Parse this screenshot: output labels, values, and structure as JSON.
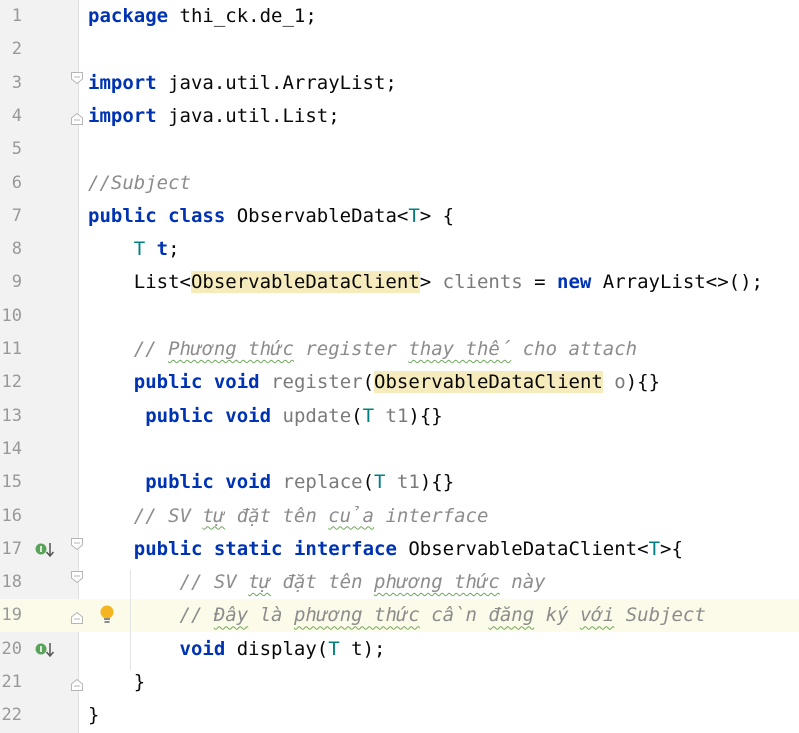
{
  "editor": {
    "lines": [
      {
        "n": "1",
        "tokens": [
          {
            "t": "package",
            "c": "kw"
          },
          {
            "t": " thi_ck.de_1;"
          }
        ]
      },
      {
        "n": "2",
        "tokens": []
      },
      {
        "n": "3",
        "tokens": [
          {
            "t": "import",
            "c": "kw"
          },
          {
            "t": " java.util.ArrayList;"
          }
        ]
      },
      {
        "n": "4",
        "tokens": [
          {
            "t": "import",
            "c": "kw"
          },
          {
            "t": " java.util.List;"
          }
        ]
      },
      {
        "n": "5",
        "tokens": []
      },
      {
        "n": "6",
        "tokens": [
          {
            "t": "//Subject",
            "c": "cm"
          }
        ]
      },
      {
        "n": "7",
        "tokens": [
          {
            "t": "public",
            "c": "kw"
          },
          {
            "t": " "
          },
          {
            "t": "class",
            "c": "kw"
          },
          {
            "t": " ObservableData<"
          },
          {
            "t": "T",
            "c": "tp"
          },
          {
            "t": "> {"
          }
        ]
      },
      {
        "n": "8",
        "tokens": [
          {
            "t": "    "
          },
          {
            "t": "T",
            "c": "tp"
          },
          {
            "t": " "
          },
          {
            "t": "t",
            "c": "kw"
          },
          {
            "t": ";"
          }
        ]
      },
      {
        "n": "9",
        "tokens": [
          {
            "t": "    List<"
          },
          {
            "t": "ObservableDataClient",
            "c": "hl"
          },
          {
            "t": "> "
          },
          {
            "t": "clients",
            "c": "gr"
          },
          {
            "t": " = "
          },
          {
            "t": "new",
            "c": "kw"
          },
          {
            "t": " ArrayList<>();"
          }
        ]
      },
      {
        "n": "10",
        "tokens": []
      },
      {
        "n": "11",
        "tokens": [
          {
            "t": "    // ",
            "c": "cm"
          },
          {
            "t": "Phương thức",
            "c": "cm wav"
          },
          {
            "t": " register ",
            "c": "cm"
          },
          {
            "t": "thay thế",
            "c": "cm wav"
          },
          {
            "t": " cho attach",
            "c": "cm"
          }
        ]
      },
      {
        "n": "12",
        "tokens": [
          {
            "t": "    "
          },
          {
            "t": "public",
            "c": "kw"
          },
          {
            "t": " "
          },
          {
            "t": "void",
            "c": "kw"
          },
          {
            "t": " "
          },
          {
            "t": "register",
            "c": "gr"
          },
          {
            "t": "("
          },
          {
            "t": "ObservableDataClient",
            "c": "hl"
          },
          {
            "t": " "
          },
          {
            "t": "o",
            "c": "gr"
          },
          {
            "t": "){}"
          }
        ]
      },
      {
        "n": "13",
        "tokens": [
          {
            "t": "     "
          },
          {
            "t": "public",
            "c": "kw"
          },
          {
            "t": " "
          },
          {
            "t": "void",
            "c": "kw"
          },
          {
            "t": " "
          },
          {
            "t": "update",
            "c": "gr"
          },
          {
            "t": "("
          },
          {
            "t": "T",
            "c": "tp"
          },
          {
            "t": " "
          },
          {
            "t": "t1",
            "c": "gr"
          },
          {
            "t": "){}"
          }
        ]
      },
      {
        "n": "14",
        "tokens": []
      },
      {
        "n": "15",
        "tokens": [
          {
            "t": "     "
          },
          {
            "t": "public",
            "c": "kw"
          },
          {
            "t": " "
          },
          {
            "t": "void",
            "c": "kw"
          },
          {
            "t": " "
          },
          {
            "t": "replace",
            "c": "gr"
          },
          {
            "t": "("
          },
          {
            "t": "T",
            "c": "tp"
          },
          {
            "t": " "
          },
          {
            "t": "t1",
            "c": "gr"
          },
          {
            "t": "){}"
          }
        ]
      },
      {
        "n": "16",
        "tokens": [
          {
            "t": "    // SV ",
            "c": "cm"
          },
          {
            "t": "tự",
            "c": "cm wav"
          },
          {
            "t": " đặt tên ",
            "c": "cm"
          },
          {
            "t": "của",
            "c": "cm wav"
          },
          {
            "t": " interface",
            "c": "cm"
          }
        ]
      },
      {
        "n": "17",
        "tokens": [
          {
            "t": "    "
          },
          {
            "t": "public",
            "c": "kw"
          },
          {
            "t": " "
          },
          {
            "t": "static",
            "c": "kw"
          },
          {
            "t": " "
          },
          {
            "t": "interface",
            "c": "kw"
          },
          {
            "t": " ObservableDataClient<"
          },
          {
            "t": "T",
            "c": "tp"
          },
          {
            "t": ">{"
          }
        ]
      },
      {
        "n": "18",
        "tokens": [
          {
            "t": "        // SV ",
            "c": "cm"
          },
          {
            "t": "tự",
            "c": "cm wav"
          },
          {
            "t": " đặt tên ",
            "c": "cm"
          },
          {
            "t": "phương thức",
            "c": "cm wav"
          },
          {
            "t": " này",
            "c": "cm"
          }
        ]
      },
      {
        "n": "19",
        "tokens": [
          {
            "t": "        // ",
            "c": "cm"
          },
          {
            "t": "Đây",
            "c": "cm wav"
          },
          {
            "t": " là ",
            "c": "cm"
          },
          {
            "t": "phương thức",
            "c": "cm wav"
          },
          {
            "t": " cần ",
            "c": "cm"
          },
          {
            "t": "đăng",
            "c": "cm wav"
          },
          {
            "t": " ký ",
            "c": "cm"
          },
          {
            "t": "với",
            "c": "cm wav"
          },
          {
            "t": " Subject",
            "c": "cm"
          }
        ]
      },
      {
        "n": "20",
        "tokens": [
          {
            "t": "        "
          },
          {
            "t": "void",
            "c": "kw"
          },
          {
            "t": " display("
          },
          {
            "t": "T",
            "c": "tp"
          },
          {
            "t": " t);"
          }
        ]
      },
      {
        "n": "21",
        "tokens": [
          {
            "t": "    }"
          }
        ]
      },
      {
        "n": "22",
        "tokens": [
          {
            "t": "}"
          }
        ]
      }
    ],
    "current_line": "19",
    "gutter_icons": [
      {
        "line": "17",
        "icon": "implemented-interface-icon"
      },
      {
        "line": "20",
        "icon": "implemented-method-icon"
      },
      {
        "line": "19",
        "icon": "lightbulb-icon"
      }
    ],
    "fold_markers": [
      {
        "line": "3",
        "icon": "fold-open-icon"
      },
      {
        "line": "4",
        "icon": "fold-close-icon"
      },
      {
        "line": "17",
        "icon": "fold-open-icon"
      },
      {
        "line": "18",
        "icon": "fold-open-icon"
      },
      {
        "line": "19",
        "icon": "fold-close-icon"
      },
      {
        "line": "21",
        "icon": "fold-close-icon"
      }
    ],
    "colors": {
      "keyword": "#0033b3",
      "type_param": "#008080",
      "comment": "#8c8c8c",
      "unused": "#7a7a7a",
      "highlight": "#f6ebbc",
      "current_line": "#fcfae8",
      "gutter": "#f2f2f2"
    }
  }
}
